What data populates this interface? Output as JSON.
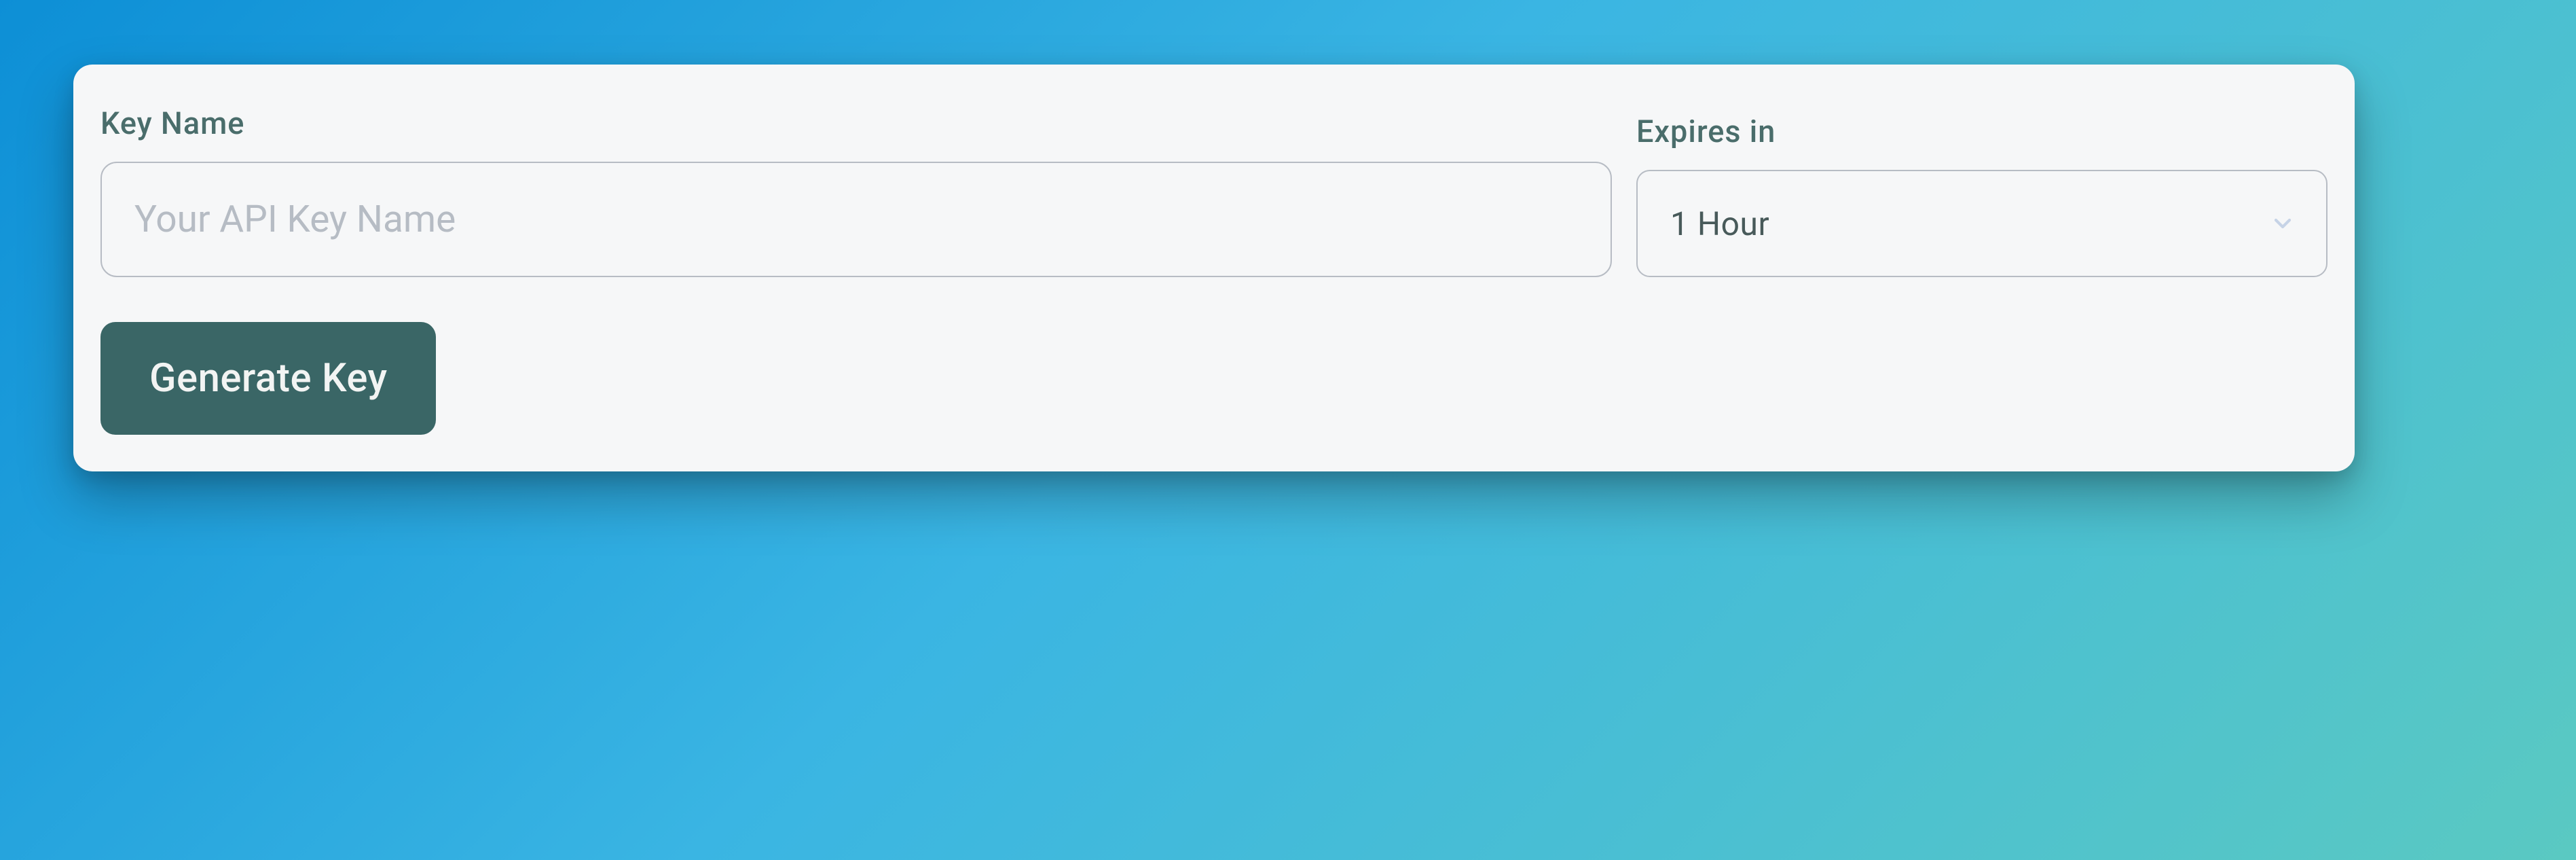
{
  "form": {
    "keyName": {
      "label": "Key Name",
      "placeholder": "Your API Key Name",
      "value": ""
    },
    "expires": {
      "label": "Expires in",
      "selected": "1 Hour"
    },
    "submit": {
      "label": "Generate Key"
    }
  }
}
